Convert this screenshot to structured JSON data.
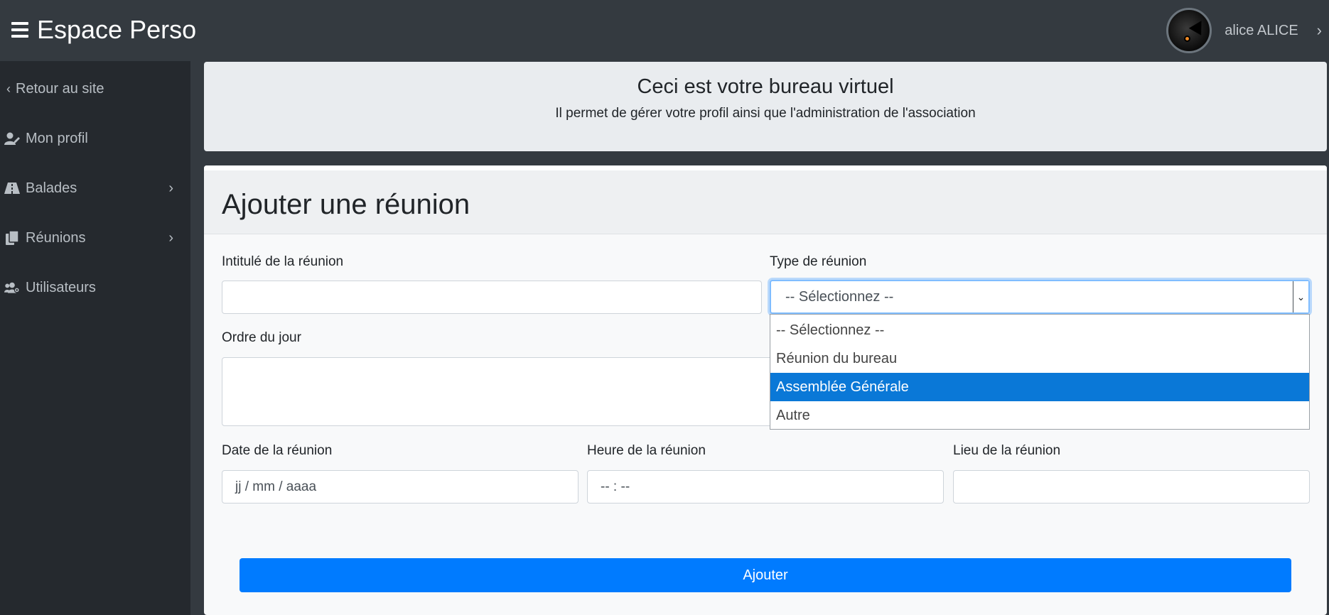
{
  "header": {
    "brand_title": "Espace Perso",
    "username": "alice ALICE"
  },
  "sidebar": {
    "items": [
      {
        "label": "Retour au site",
        "icon": "chevron-left-icon"
      },
      {
        "label": "Mon profil",
        "icon": "user-edit-icon"
      },
      {
        "label": "Balades",
        "icon": "road-icon",
        "has_submenu": true
      },
      {
        "label": "Réunions",
        "icon": "copy-icon",
        "has_submenu": true
      },
      {
        "label": "Utilisateurs",
        "icon": "users-cog-icon"
      }
    ]
  },
  "jumbotron": {
    "title": "Ceci est votre bureau virtuel",
    "subtitle": "Il permet de gérer votre profil ainsi que l'administration de l'association"
  },
  "form": {
    "title": "Ajouter une réunion",
    "intitule_label": "Intitulé de la réunion",
    "intitule_value": "",
    "type_label": "Type de réunion",
    "type_selected": "-- Sélectionnez --",
    "type_options": [
      "-- Sélectionnez --",
      "Réunion du bureau",
      "Assemblée Générale",
      "Autre"
    ],
    "type_highlighted_index": 2,
    "ordre_label": "Ordre du jour",
    "ordre_value": "",
    "date_label": "Date de la réunion",
    "date_placeholder": "jj / mm / aaaa",
    "heure_label": "Heure de la réunion",
    "heure_placeholder": "-- : --",
    "lieu_label": "Lieu de la réunion",
    "lieu_value": "",
    "submit_label": "Ajouter"
  },
  "colors": {
    "topbar": "#343a40",
    "sidebar": "#25292e",
    "primary": "#007bff",
    "option_highlight": "#0a78d7"
  }
}
